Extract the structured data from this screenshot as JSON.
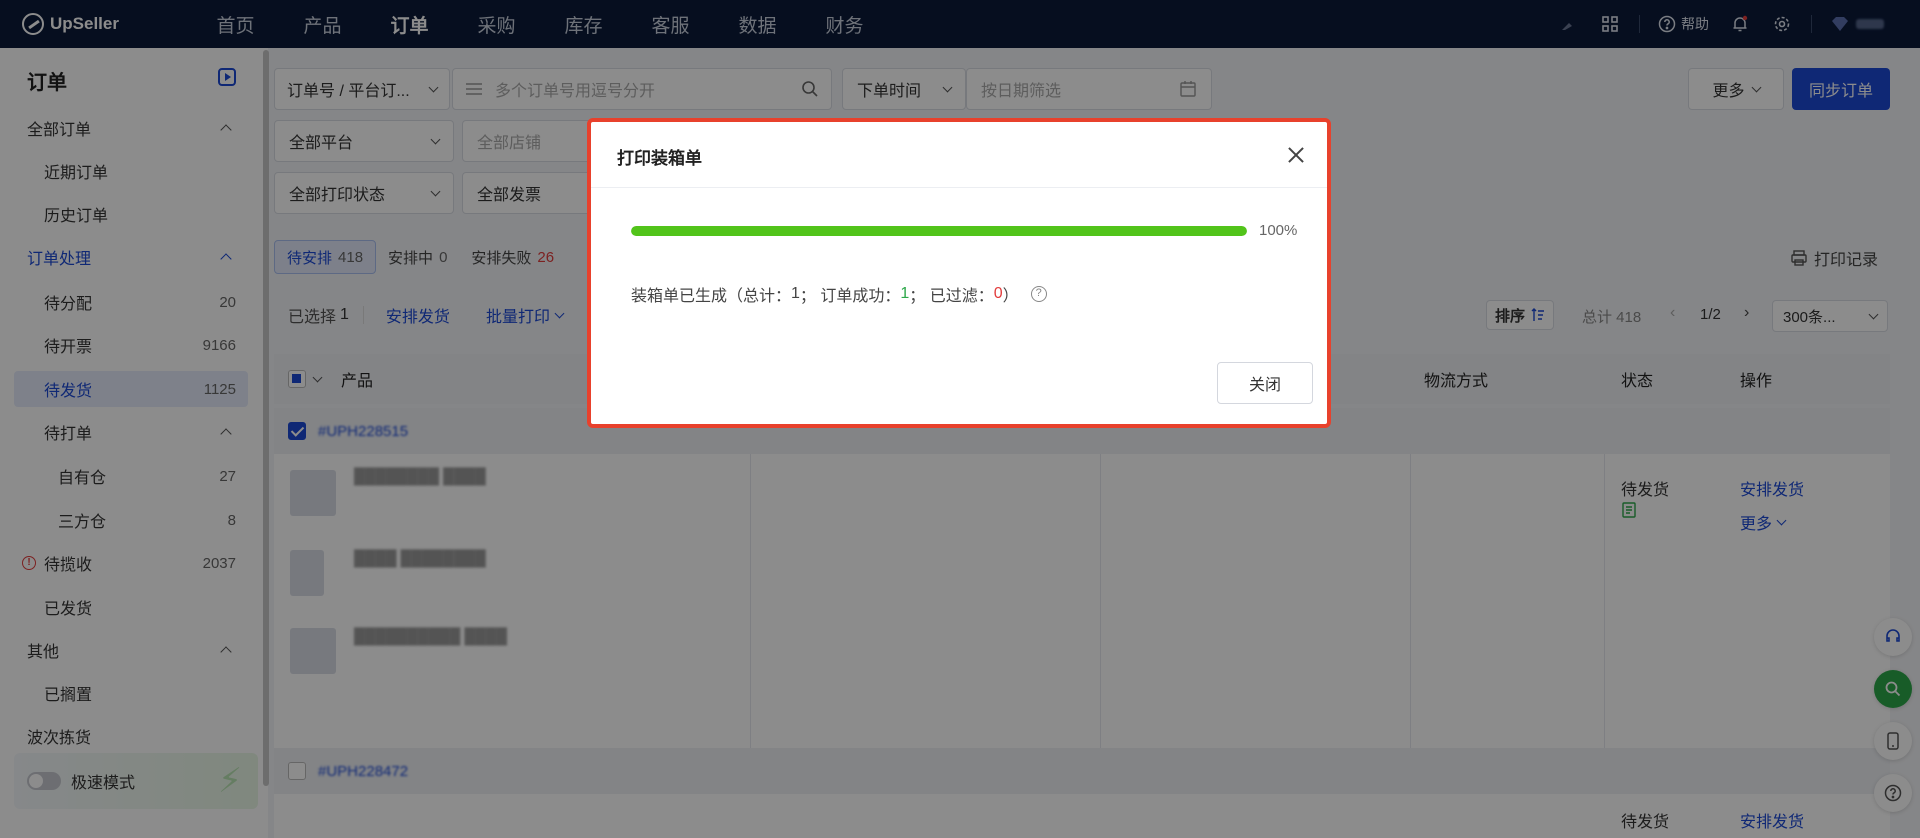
{
  "app": {
    "name": "UpSeller"
  },
  "nav": [
    "首页",
    "产品",
    "订单",
    "采购",
    "库存",
    "客服",
    "数据",
    "财务"
  ],
  "nav_active": 2,
  "topbar": {
    "help": "帮助"
  },
  "sidebar": {
    "title": "订单",
    "items": [
      {
        "label": "全部订单",
        "count": "",
        "level": "group",
        "arrow": true
      },
      {
        "label": "近期订单",
        "count": "",
        "level": "sub"
      },
      {
        "label": "历史订单",
        "count": "",
        "level": "sub"
      },
      {
        "label": "订单处理",
        "count": "",
        "level": "group",
        "arrow": true,
        "blue": true
      },
      {
        "label": "待分配",
        "count": "20",
        "level": "sub"
      },
      {
        "label": "待开票",
        "count": "9166",
        "level": "sub"
      },
      {
        "label": "待发货",
        "count": "1125",
        "level": "sub",
        "active": true
      },
      {
        "label": "待打单",
        "count": "",
        "level": "sub",
        "arrow": true
      },
      {
        "label": "自有仓",
        "count": "27",
        "level": "sub2"
      },
      {
        "label": "三方仓",
        "count": "8",
        "level": "sub2"
      },
      {
        "label": "待揽收",
        "count": "2037",
        "level": "sub",
        "warn": true
      },
      {
        "label": "已发货",
        "count": "",
        "level": "sub"
      },
      {
        "label": "其他",
        "count": "",
        "level": "group",
        "arrow": true
      },
      {
        "label": "已搁置",
        "count": "",
        "level": "sub"
      },
      {
        "label": "波次拣货",
        "count": "",
        "level": "group"
      }
    ],
    "speed_mode": "极速模式"
  },
  "filters": {
    "search_type": "订单号 / 平台订...",
    "search_placeholder": "多个订单号用逗号分开",
    "time_type": "下单时间",
    "date_placeholder": "按日期筛选",
    "platform": "全部平台",
    "shop_placeholder": "全部店铺",
    "print_status": "全部打印状态",
    "invoice": "全部发票",
    "more": "更多",
    "sync": "同步订单"
  },
  "tabs": [
    {
      "label": "待安排",
      "count": "418",
      "active": true
    },
    {
      "label": "安排中",
      "count": "0"
    },
    {
      "label": "安排失败",
      "count": "26",
      "red": true
    }
  ],
  "print_log": "打印记录",
  "actions": {
    "selected_label": "已选择",
    "selected_count": "1",
    "arrange": "安排发货",
    "batch_print": "批量打印",
    "sort": "排序",
    "total": "总计 418",
    "page": "1/2",
    "per_page": "300条..."
  },
  "table_headers": {
    "product": "产品",
    "logistics": "物流方式",
    "status": "状态",
    "action": "操作"
  },
  "orders": [
    {
      "id": "#UPH228515",
      "status": "待发货",
      "action": "安排发货",
      "more": "更多"
    },
    {
      "id": "#UPH228472",
      "status": "待发货",
      "action": "安排发货"
    }
  ],
  "modal": {
    "title": "打印装箱单",
    "progress_pct": 100,
    "progress_label": "100%",
    "result_prefix": "装箱单已生成（总计：",
    "total": "1",
    "sep1": "；  订单成功：",
    "success": "1",
    "sep2": "；  已过滤：",
    "filtered": "0",
    "result_suffix": "）",
    "close_button": "关闭"
  },
  "colors": {
    "brand": "#1c49d6",
    "progress": "#52c41a",
    "modal_border": "#e8412c",
    "topbar": "#0b1a3a"
  }
}
